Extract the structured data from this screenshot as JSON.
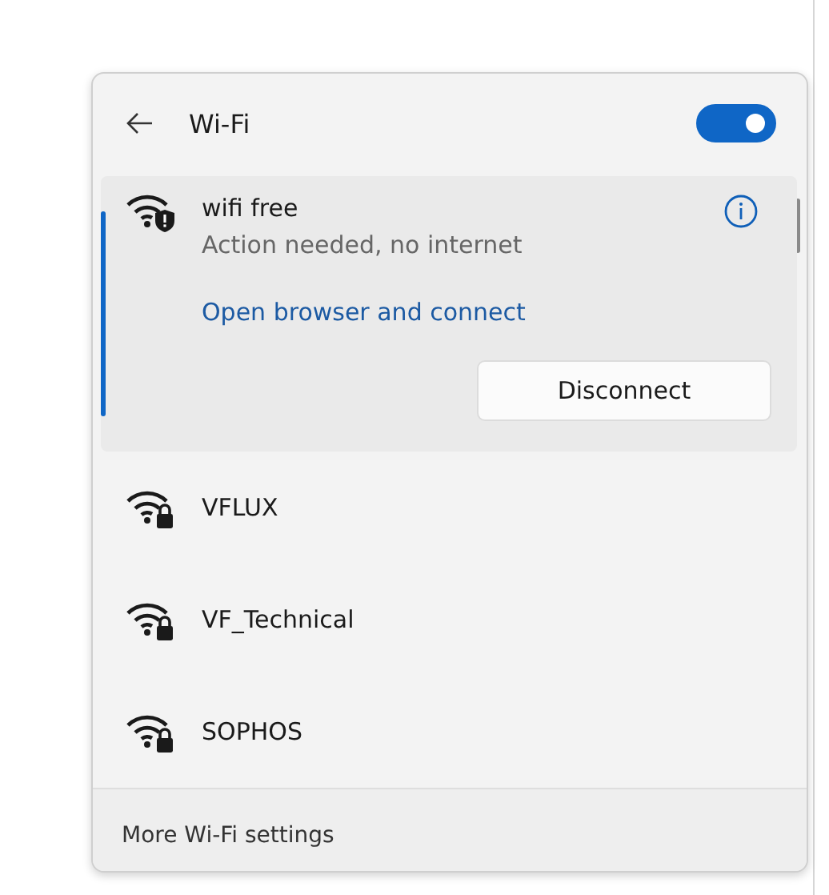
{
  "header": {
    "title": "Wi-Fi",
    "wifi_on": true
  },
  "networks": [
    {
      "name": "wifi free",
      "status": "Action needed, no internet",
      "link": "Open browser and connect",
      "button": "Disconnect",
      "selected": true,
      "kind": "warning"
    },
    {
      "name": "VFLUX",
      "selected": false,
      "kind": "secured"
    },
    {
      "name": "VF_Technical",
      "selected": false,
      "kind": "secured"
    },
    {
      "name": "SOPHOS",
      "selected": false,
      "kind": "secured"
    }
  ],
  "footer": {
    "link": "More Wi-Fi settings"
  }
}
